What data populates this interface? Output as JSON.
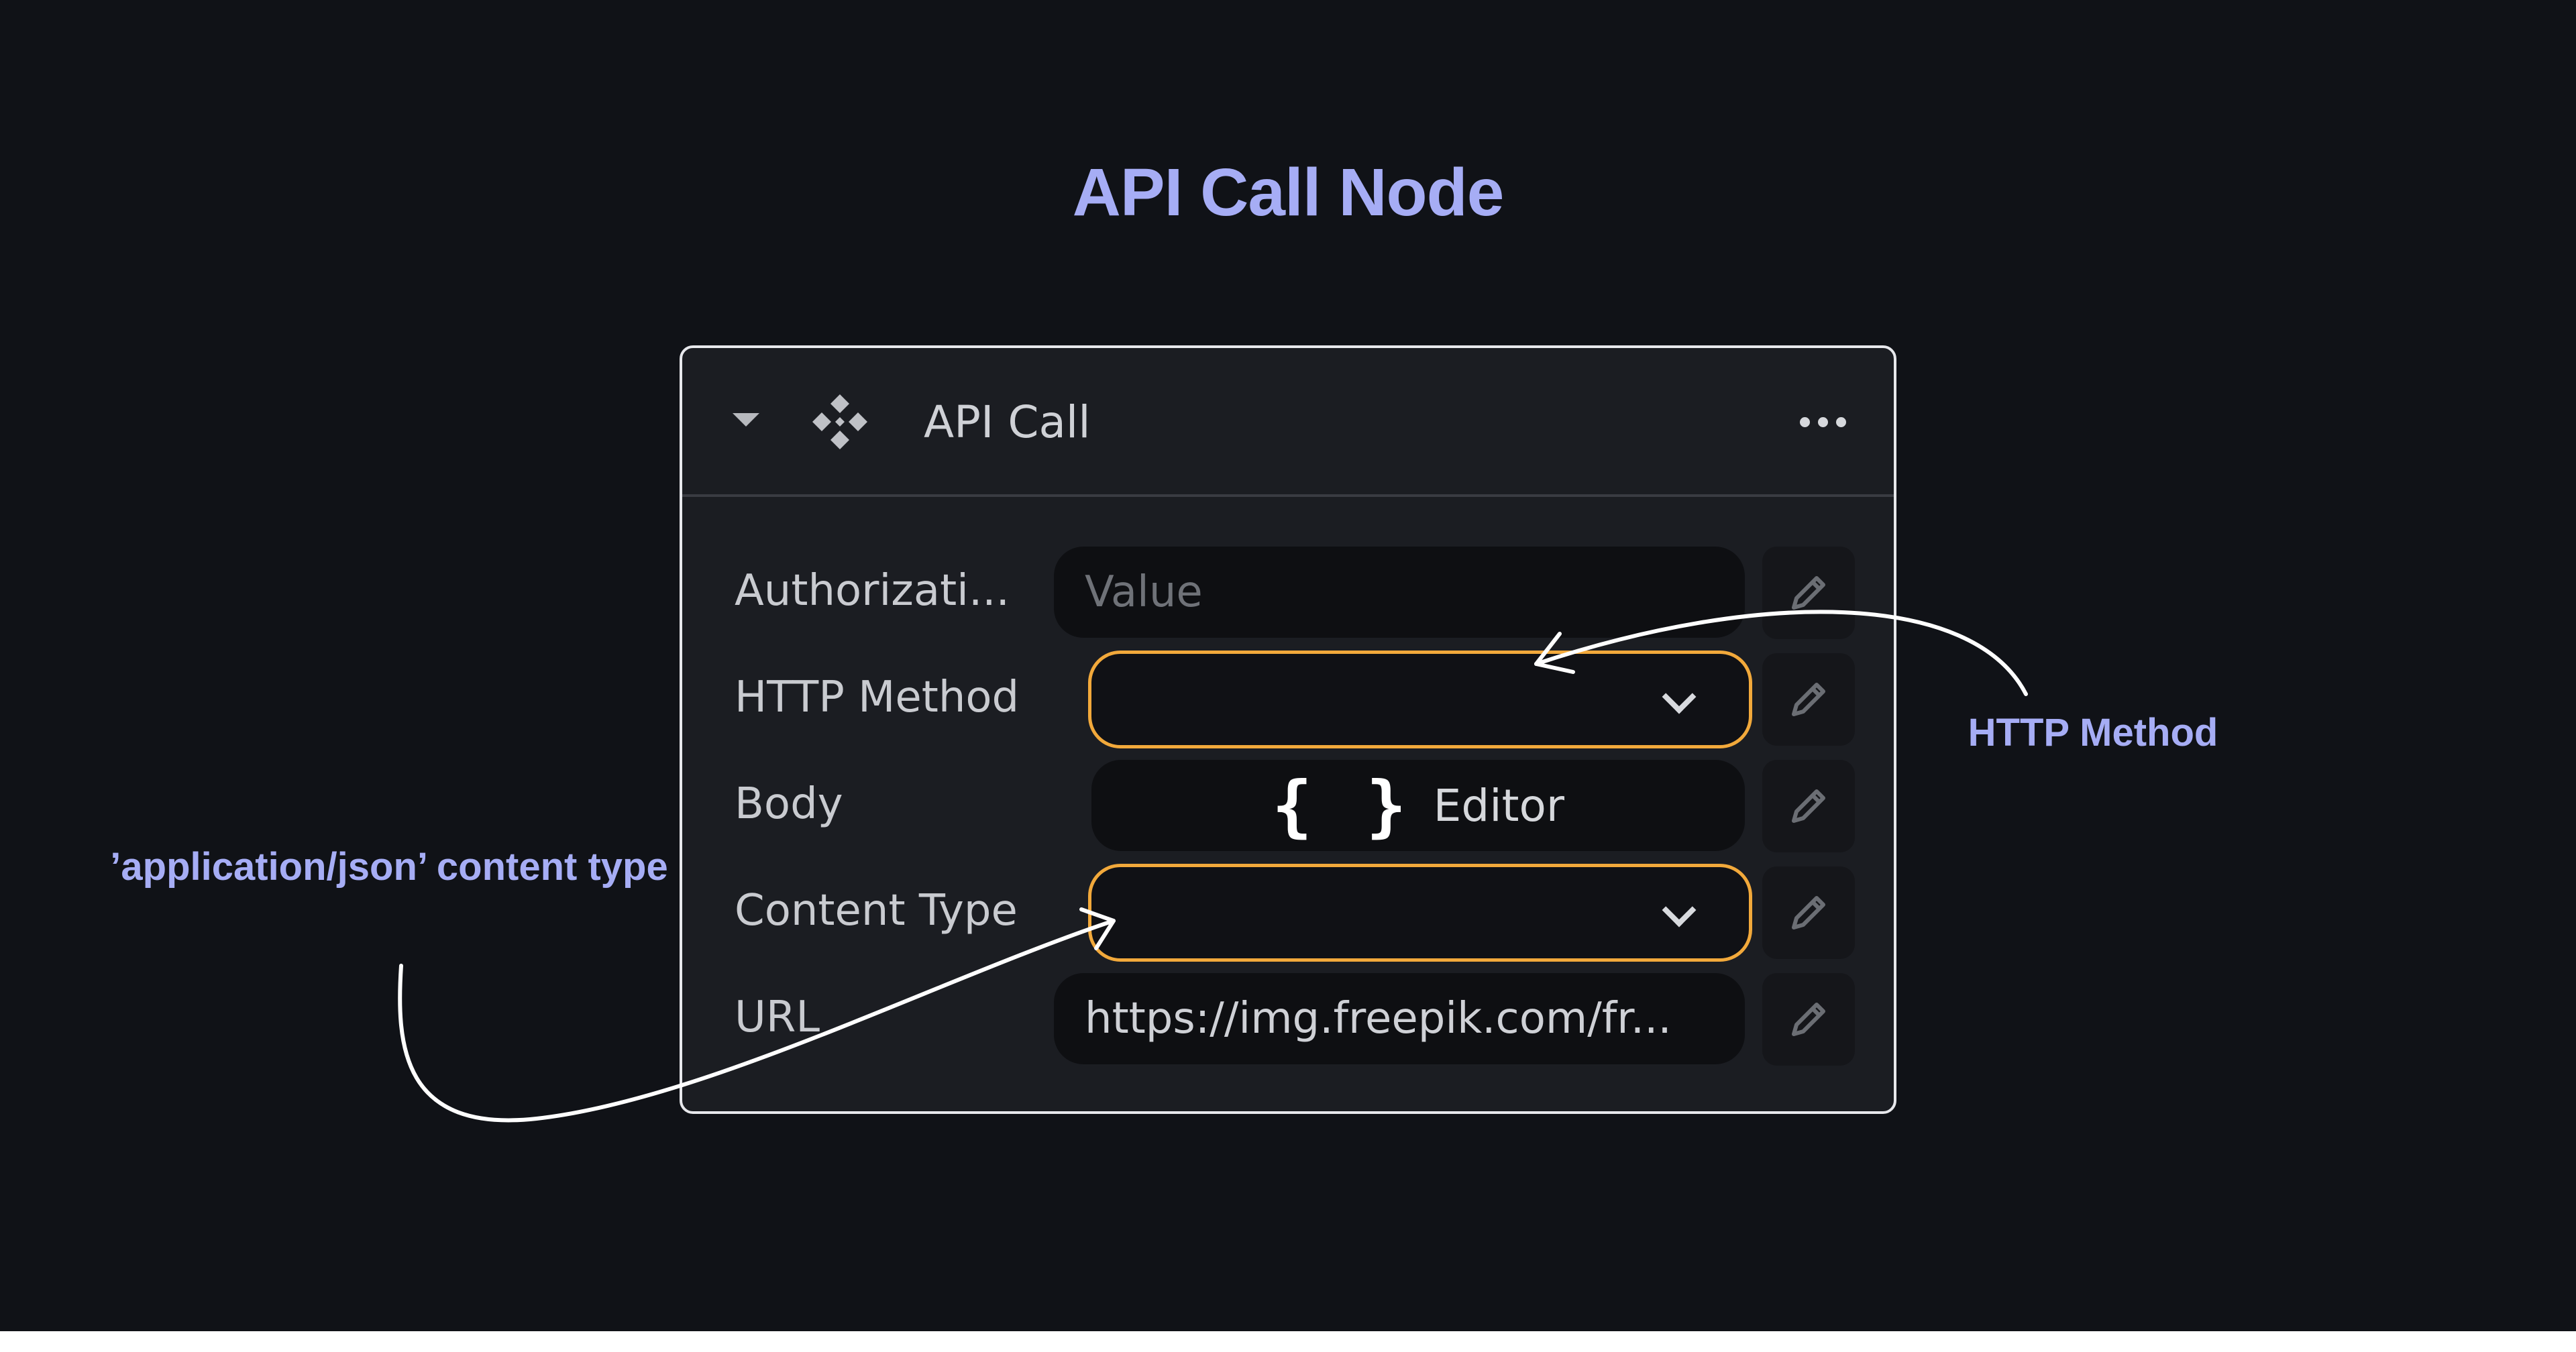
{
  "page_title": "API Call Node",
  "annotations": {
    "http_method": "HTTP Method",
    "content_type": "’application/json’ content type"
  },
  "node": {
    "title": "API Call",
    "icon": "api-diamond-icon",
    "rows": {
      "authorization": {
        "label": "Authorizati...",
        "placeholder": "Value"
      },
      "http_method": {
        "label": "HTTP Method",
        "value": ""
      },
      "body": {
        "label": "Body",
        "braces": "{ }",
        "button_label": "Editor"
      },
      "content_type": {
        "label": "Content Type",
        "value": ""
      },
      "url": {
        "label": "URL",
        "value": "https://img.freepik.com/fr..."
      }
    }
  },
  "colors": {
    "background": "#101217",
    "accent_text": "#a6adf5",
    "highlight_border": "#f2a93b",
    "node_bg": "#1b1d22"
  }
}
